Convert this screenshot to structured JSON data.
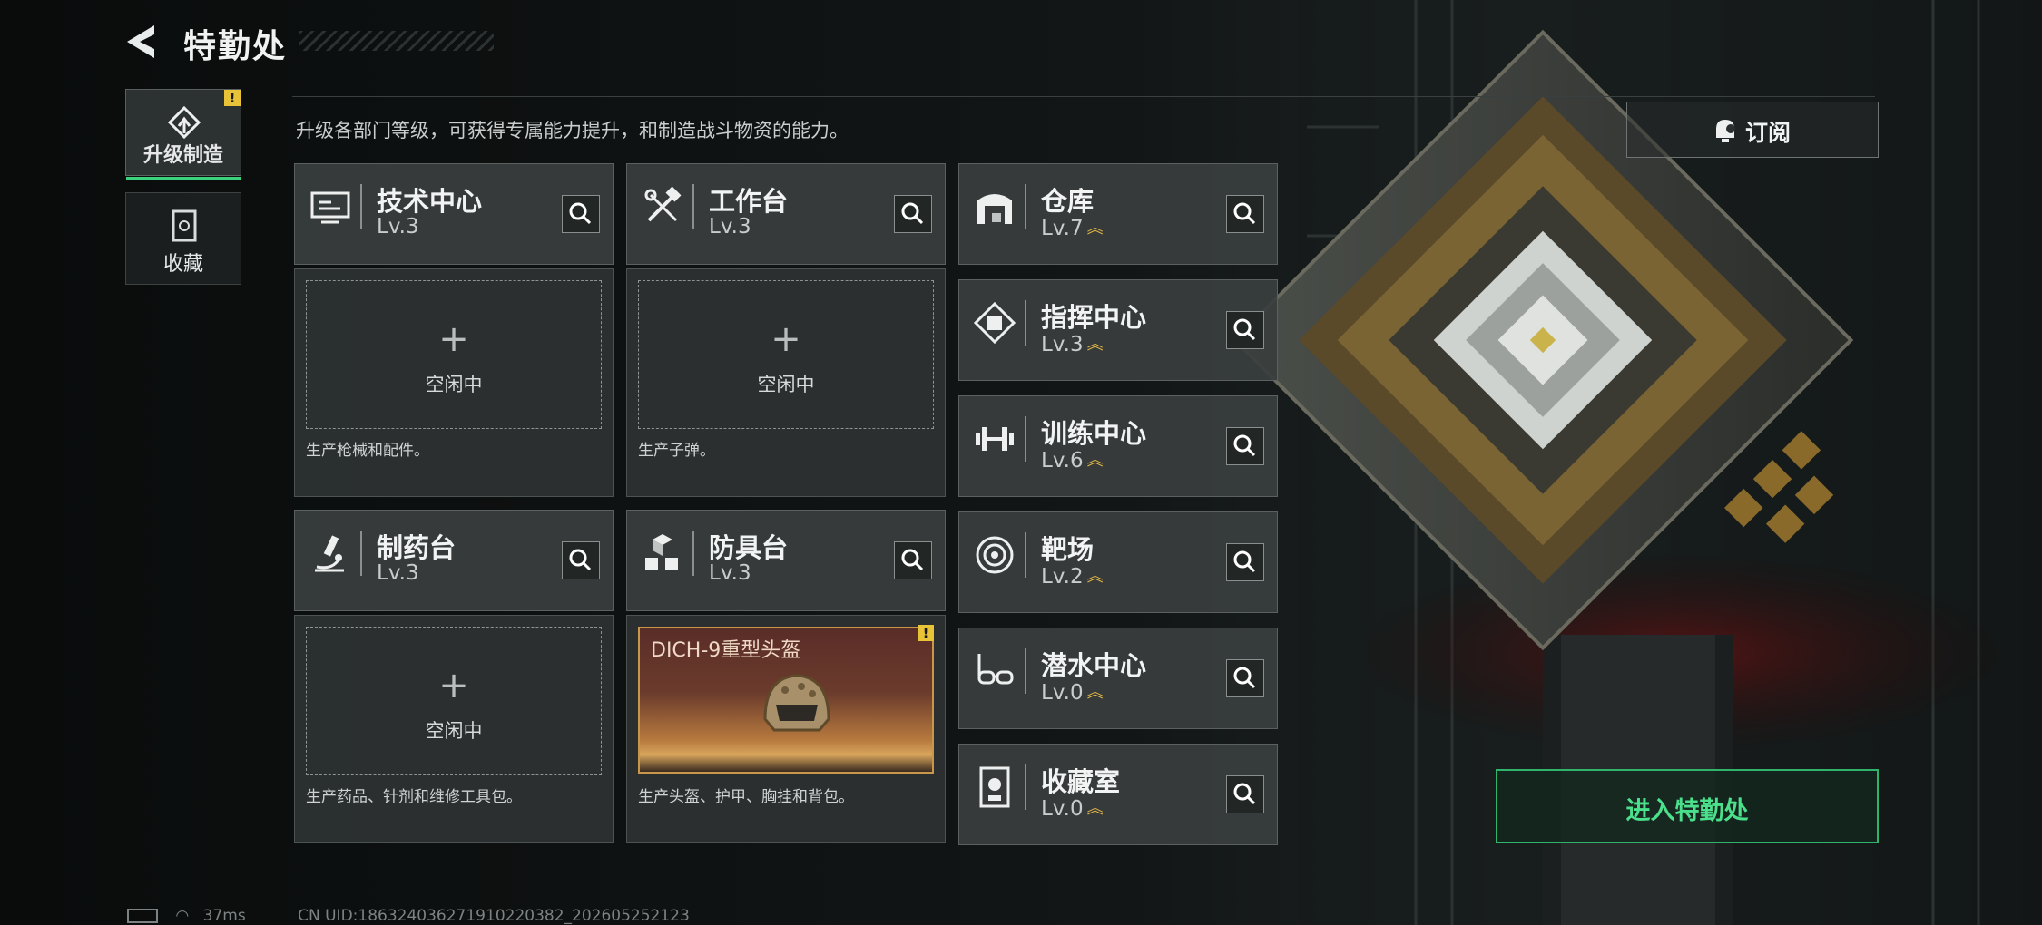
{
  "header": {
    "title": "特勤处"
  },
  "tabs": [
    {
      "label": "升级制造",
      "active": true,
      "alert": "!"
    },
    {
      "label": "收藏",
      "active": false
    }
  ],
  "description": "升级各部门等级，可获得专属能力提升，和制造战斗物资的能力。",
  "facilities_left": [
    {
      "name": "技术中心",
      "level": "Lv.3",
      "icon": "monitor-icon",
      "slot": {
        "state": "empty",
        "plus": "+",
        "status": "空闲中",
        "caption": "生产枪械和配件。"
      }
    },
    {
      "name": "工作台",
      "level": "Lv.3",
      "icon": "hammer-wrench-icon",
      "slot": {
        "state": "empty",
        "plus": "+",
        "status": "空闲中",
        "caption": "生产子弹。"
      }
    },
    {
      "name": "制药台",
      "level": "Lv.3",
      "icon": "microscope-icon",
      "slot": {
        "state": "empty",
        "plus": "+",
        "status": "空闲中",
        "caption": "生产药品、针剂和维修工具包。"
      }
    },
    {
      "name": "防具台",
      "level": "Lv.3",
      "icon": "armor-blocks-icon",
      "slot": {
        "state": "producing",
        "product": "DICH-9重型头盔",
        "alert": "!",
        "caption": "生产头盔、护甲、胸挂和背包。"
      }
    }
  ],
  "facilities_right": [
    {
      "name": "仓库",
      "level": "Lv.7",
      "icon": "warehouse-icon",
      "upgradable": true
    },
    {
      "name": "指挥中心",
      "level": "Lv.3",
      "icon": "command-chip-icon",
      "upgradable": true
    },
    {
      "name": "训练中心",
      "level": "Lv.6",
      "icon": "dumbbell-icon",
      "upgradable": true
    },
    {
      "name": "靶场",
      "level": "Lv.2",
      "icon": "target-icon",
      "upgradable": true
    },
    {
      "name": "潜水中心",
      "level": "Lv.0",
      "icon": "diving-goggles-icon",
      "upgradable": true
    },
    {
      "name": "收藏室",
      "level": "Lv.0",
      "icon": "collection-case-icon",
      "upgradable": true
    }
  ],
  "upgrade_glyph": "︽",
  "subscribe_label": "订阅",
  "enter_label": "进入特勤处",
  "status_bar": {
    "ping": "37ms",
    "uid": "CN UID:18632403627191022038​2_202605252123"
  },
  "colors": {
    "accent_green": "#3ad27c",
    "warning_yellow": "#e9c337",
    "upgrade_gold": "#e2b84a"
  }
}
